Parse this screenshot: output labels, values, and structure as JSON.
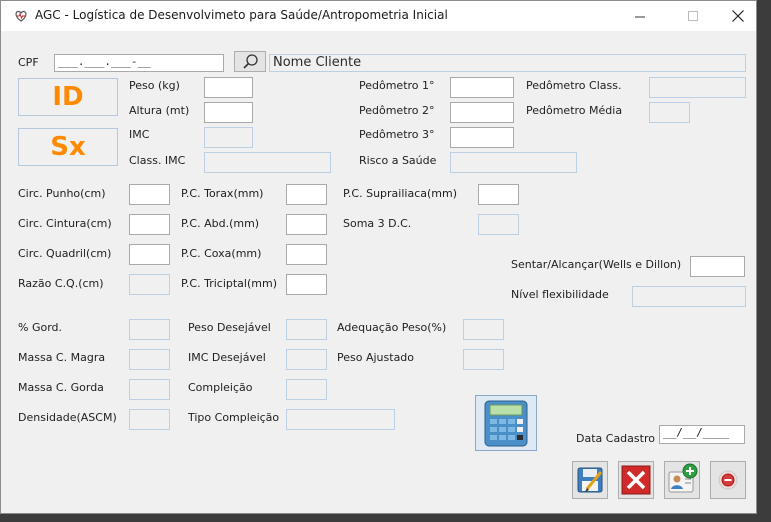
{
  "window": {
    "title": "AGC - Logística de Desenvolvimeto para Saúde/Antropometria Inicial"
  },
  "cpf": {
    "label": "CPF",
    "mask": "___.___.___-__",
    "nome_placeholder": "Nome Cliente"
  },
  "badges": {
    "id": "ID",
    "sx": "Sx"
  },
  "labels": {
    "peso": "Peso (kg)",
    "altura": "Altura (mt)",
    "imc": "IMC",
    "class_imc": "Class. IMC",
    "ped1": "Pedômetro 1°",
    "ped2": "Pedômetro 2°",
    "ped3": "Pedômetro 3°",
    "risco": "Risco a Saúde",
    "ped_class": "Pedômetro Class.",
    "ped_media": "Pedômetro Média",
    "punho": "Circ. Punho(cm)",
    "cintura": "Circ. Cintura(cm)",
    "quadril": "Circ. Quadril(cm)",
    "razao": "Razão C.Q.(cm)",
    "torax": "P.C. Torax(mm)",
    "abd": "P.C. Abd.(mm)",
    "coxa": "P.C. Coxa(mm)",
    "triciptal": "P.C. Triciptal(mm)",
    "suprailiaca": "P.C. Suprailiaca(mm)",
    "soma3": "Soma 3 D.C.",
    "sentar": "Sentar/Alcançar(Wells e Dillon)",
    "nivel_flex": "Nível flexibilidade",
    "gord": "% Gord.",
    "massa_magra": "Massa C. Magra",
    "massa_gorda": "Massa C. Gorda",
    "densidade": "Densidade(ASCM)",
    "peso_desejavel": "Peso Desejável",
    "imc_desejavel": "IMC Desejável",
    "compleicao": "Compleição",
    "tipo_compleicao": "Tipo Compleição",
    "adequacao_peso": "Adequação Peso(%)",
    "peso_ajustado": "Peso Ajustado",
    "data_cadastro": "Data Cadastro"
  },
  "data_cadastro_mask": "__/__/____",
  "icons": {
    "search": "magnifier-icon",
    "calculator": "calculator-icon",
    "save": "save-icon",
    "cancel": "close-icon",
    "add": "add-user-icon",
    "remove": "remove-icon"
  },
  "colors": {
    "badge_text": "#ff8a00",
    "readonly_border": "#bdd0e3"
  }
}
